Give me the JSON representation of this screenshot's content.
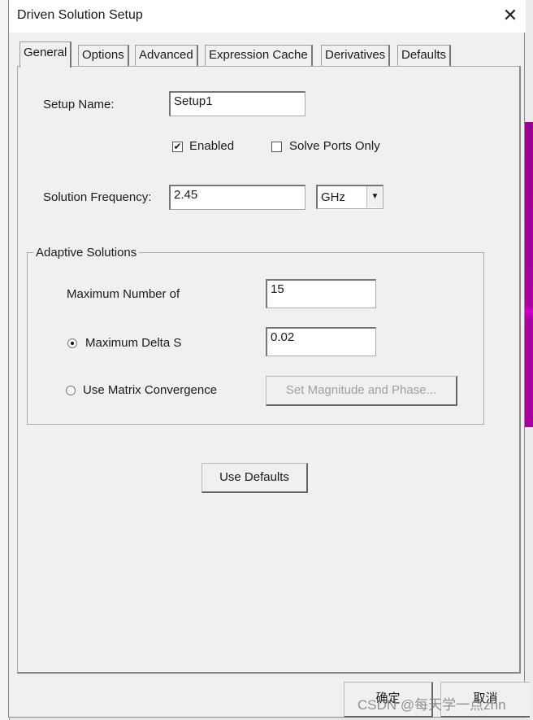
{
  "window": {
    "title": "Driven Solution Setup",
    "close_icon": "close-icon"
  },
  "tabs": [
    {
      "label": "General",
      "active": true
    },
    {
      "label": "Options"
    },
    {
      "label": "Advanced"
    },
    {
      "label": "Expression Cache"
    },
    {
      "label": "Derivatives"
    },
    {
      "label": "Defaults"
    }
  ],
  "general": {
    "setup_name_label": "Setup Name:",
    "setup_name_value": "Setup1",
    "enabled_label": "Enabled",
    "enabled_checked": true,
    "solve_ports_label": "Solve Ports Only",
    "solve_ports_checked": false,
    "frequency_label": "Solution Frequency:",
    "frequency_value": "2.45",
    "frequency_unit": "GHz",
    "adaptive": {
      "title": "Adaptive Solutions",
      "max_passes_label": "Maximum Number of",
      "max_passes_value": "15",
      "delta_s_label": "Maximum Delta S",
      "delta_s_value": "0.02",
      "delta_s_selected": true,
      "matrix_label": "Use Matrix Convergence",
      "matrix_selected": false,
      "set_mag_phase_label": "Set Magnitude and Phase..."
    },
    "use_defaults_label": "Use Defaults"
  },
  "footer": {
    "ok_label": "确定",
    "cancel_label": "取消"
  },
  "watermark": "CSDN @每天学一点zhn",
  "colors": {
    "background_shape": "#a800a0"
  }
}
